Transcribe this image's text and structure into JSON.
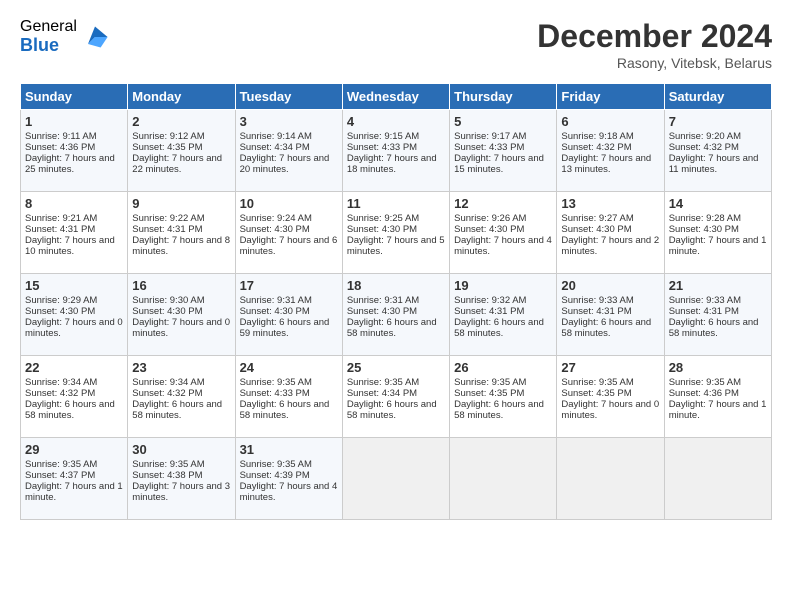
{
  "logo": {
    "general": "General",
    "blue": "Blue"
  },
  "header": {
    "month": "December 2024",
    "location": "Rasony, Vitebsk, Belarus"
  },
  "days": [
    "Sunday",
    "Monday",
    "Tuesday",
    "Wednesday",
    "Thursday",
    "Friday",
    "Saturday"
  ],
  "weeks": [
    [
      {
        "day": "1",
        "sunrise": "9:11 AM",
        "sunset": "4:36 PM",
        "daylight": "7 hours and 25 minutes."
      },
      {
        "day": "2",
        "sunrise": "9:12 AM",
        "sunset": "4:35 PM",
        "daylight": "7 hours and 22 minutes."
      },
      {
        "day": "3",
        "sunrise": "9:14 AM",
        "sunset": "4:34 PM",
        "daylight": "7 hours and 20 minutes."
      },
      {
        "day": "4",
        "sunrise": "9:15 AM",
        "sunset": "4:33 PM",
        "daylight": "7 hours and 18 minutes."
      },
      {
        "day": "5",
        "sunrise": "9:17 AM",
        "sunset": "4:33 PM",
        "daylight": "7 hours and 15 minutes."
      },
      {
        "day": "6",
        "sunrise": "9:18 AM",
        "sunset": "4:32 PM",
        "daylight": "7 hours and 13 minutes."
      },
      {
        "day": "7",
        "sunrise": "9:20 AM",
        "sunset": "4:32 PM",
        "daylight": "7 hours and 11 minutes."
      }
    ],
    [
      {
        "day": "8",
        "sunrise": "9:21 AM",
        "sunset": "4:31 PM",
        "daylight": "7 hours and 10 minutes."
      },
      {
        "day": "9",
        "sunrise": "9:22 AM",
        "sunset": "4:31 PM",
        "daylight": "7 hours and 8 minutes."
      },
      {
        "day": "10",
        "sunrise": "9:24 AM",
        "sunset": "4:30 PM",
        "daylight": "7 hours and 6 minutes."
      },
      {
        "day": "11",
        "sunrise": "9:25 AM",
        "sunset": "4:30 PM",
        "daylight": "7 hours and 5 minutes."
      },
      {
        "day": "12",
        "sunrise": "9:26 AM",
        "sunset": "4:30 PM",
        "daylight": "7 hours and 4 minutes."
      },
      {
        "day": "13",
        "sunrise": "9:27 AM",
        "sunset": "4:30 PM",
        "daylight": "7 hours and 2 minutes."
      },
      {
        "day": "14",
        "sunrise": "9:28 AM",
        "sunset": "4:30 PM",
        "daylight": "7 hours and 1 minute."
      }
    ],
    [
      {
        "day": "15",
        "sunrise": "9:29 AM",
        "sunset": "4:30 PM",
        "daylight": "7 hours and 0 minutes."
      },
      {
        "day": "16",
        "sunrise": "9:30 AM",
        "sunset": "4:30 PM",
        "daylight": "7 hours and 0 minutes."
      },
      {
        "day": "17",
        "sunrise": "9:31 AM",
        "sunset": "4:30 PM",
        "daylight": "6 hours and 59 minutes."
      },
      {
        "day": "18",
        "sunrise": "9:31 AM",
        "sunset": "4:30 PM",
        "daylight": "6 hours and 58 minutes."
      },
      {
        "day": "19",
        "sunrise": "9:32 AM",
        "sunset": "4:31 PM",
        "daylight": "6 hours and 58 minutes."
      },
      {
        "day": "20",
        "sunrise": "9:33 AM",
        "sunset": "4:31 PM",
        "daylight": "6 hours and 58 minutes."
      },
      {
        "day": "21",
        "sunrise": "9:33 AM",
        "sunset": "4:31 PM",
        "daylight": "6 hours and 58 minutes."
      }
    ],
    [
      {
        "day": "22",
        "sunrise": "9:34 AM",
        "sunset": "4:32 PM",
        "daylight": "6 hours and 58 minutes."
      },
      {
        "day": "23",
        "sunrise": "9:34 AM",
        "sunset": "4:32 PM",
        "daylight": "6 hours and 58 minutes."
      },
      {
        "day": "24",
        "sunrise": "9:35 AM",
        "sunset": "4:33 PM",
        "daylight": "6 hours and 58 minutes."
      },
      {
        "day": "25",
        "sunrise": "9:35 AM",
        "sunset": "4:34 PM",
        "daylight": "6 hours and 58 minutes."
      },
      {
        "day": "26",
        "sunrise": "9:35 AM",
        "sunset": "4:35 PM",
        "daylight": "6 hours and 58 minutes."
      },
      {
        "day": "27",
        "sunrise": "9:35 AM",
        "sunset": "4:35 PM",
        "daylight": "7 hours and 0 minutes."
      },
      {
        "day": "28",
        "sunrise": "9:35 AM",
        "sunset": "4:36 PM",
        "daylight": "7 hours and 1 minute."
      }
    ],
    [
      {
        "day": "29",
        "sunrise": "9:35 AM",
        "sunset": "4:37 PM",
        "daylight": "7 hours and 1 minute."
      },
      {
        "day": "30",
        "sunrise": "9:35 AM",
        "sunset": "4:38 PM",
        "daylight": "7 hours and 3 minutes."
      },
      {
        "day": "31",
        "sunrise": "9:35 AM",
        "sunset": "4:39 PM",
        "daylight": "7 hours and 4 minutes."
      },
      null,
      null,
      null,
      null
    ]
  ]
}
